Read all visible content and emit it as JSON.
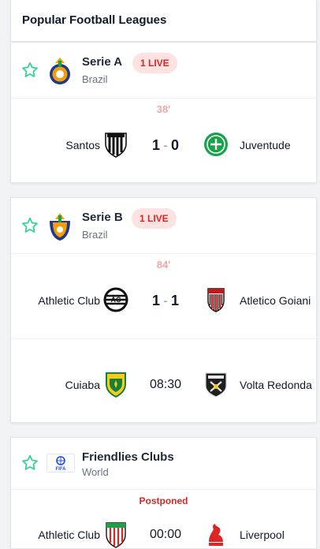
{
  "header": {
    "title": "Popular Football Leagues"
  },
  "leagues": [
    {
      "name": "Serie A",
      "country": "Brazil",
      "live_badge": "1 LIVE",
      "matches": [
        {
          "status": "38'",
          "home": "Santos",
          "away": "Juventude",
          "home_score": "1",
          "separator": "-",
          "away_score": "0"
        }
      ]
    },
    {
      "name": "Serie B",
      "country": "Brazil",
      "live_badge": "1 LIVE",
      "matches": [
        {
          "status": "84'",
          "home": "Athletic Club",
          "away": "Atletico Goiani",
          "home_score": "1",
          "separator": "-",
          "away_score": "1"
        },
        {
          "status": "",
          "home": "Cuiaba",
          "away": "Volta Redonda",
          "time": "08:30"
        }
      ]
    },
    {
      "name": "Friendlies Clubs",
      "country": "World",
      "matches": [
        {
          "status": "Postponed",
          "home": "Athletic Club",
          "away": "Liverpool",
          "time": "00:00"
        }
      ]
    }
  ],
  "icons": {
    "favorite": "star-outline-icon",
    "serie_a": "serie-a-logo",
    "serie_b": "serie-b-logo",
    "friendlies": "fifa-logo"
  },
  "colors": {
    "live": "#dc2626",
    "live_bg": "#fde2e2",
    "minute": "#f0a7a7",
    "star": "#34d399"
  }
}
